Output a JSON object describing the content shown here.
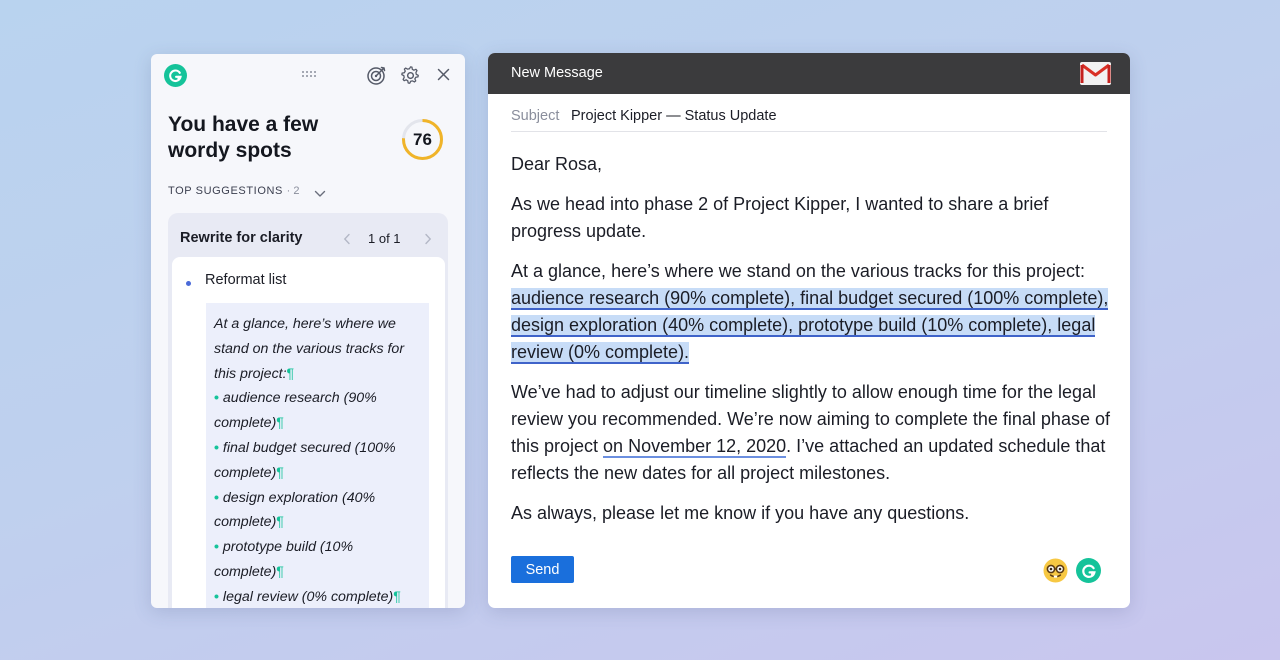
{
  "panel": {
    "heading": "You have a few wordy spots",
    "score": "76",
    "top_suggestions_label": "TOP SUGGESTIONS",
    "top_suggestions_count": "· 2",
    "card": {
      "title": "Rewrite for clarity",
      "pager": "1 of 1",
      "suggestion_label": "Reformat list",
      "preview_intro": "At a glance, here’s where we stand on the various tracks for this project:",
      "preview_items": [
        "audience research (90% complete)",
        "final budget secured (100% complete)",
        "design exploration (40% complete)",
        "prototype build (10% complete)",
        "legal review (0% complete)"
      ],
      "pilcrow": "¶"
    },
    "accent_color": "#15c39a",
    "score_ring_color": "#f0b429"
  },
  "mail": {
    "window_title": "New Message",
    "subject_label": "Subject",
    "subject_value": "Project Kipper — Status Update",
    "greeting": "Dear Rosa,",
    "para1": "As we head into phase 2 of Project Kipper, I wanted to share a brief progress update.",
    "para2_lead": "At a glance, here’s where we stand on the various tracks for this project: ",
    "para2_highlight": "audience research (90% complete), final budget secured (100% complete), design exploration (40% complete), prototype build (10% complete), legal review (0% complete).",
    "para3_a": "We’ve had to adjust our timeline slightly to allow enough time for the legal review you recommended. We’re now aiming to complete the final phase of this project ",
    "para3_date": "on November 12, 2020",
    "para3_b": ". I’ve attached an updated schedule that reflects the new dates for all project milestones.",
    "para4": "As always, please let me know if you have any questions.",
    "send_label": "Send",
    "send_color": "#1a6fdc",
    "highlight_color": "#c7dcf7"
  }
}
